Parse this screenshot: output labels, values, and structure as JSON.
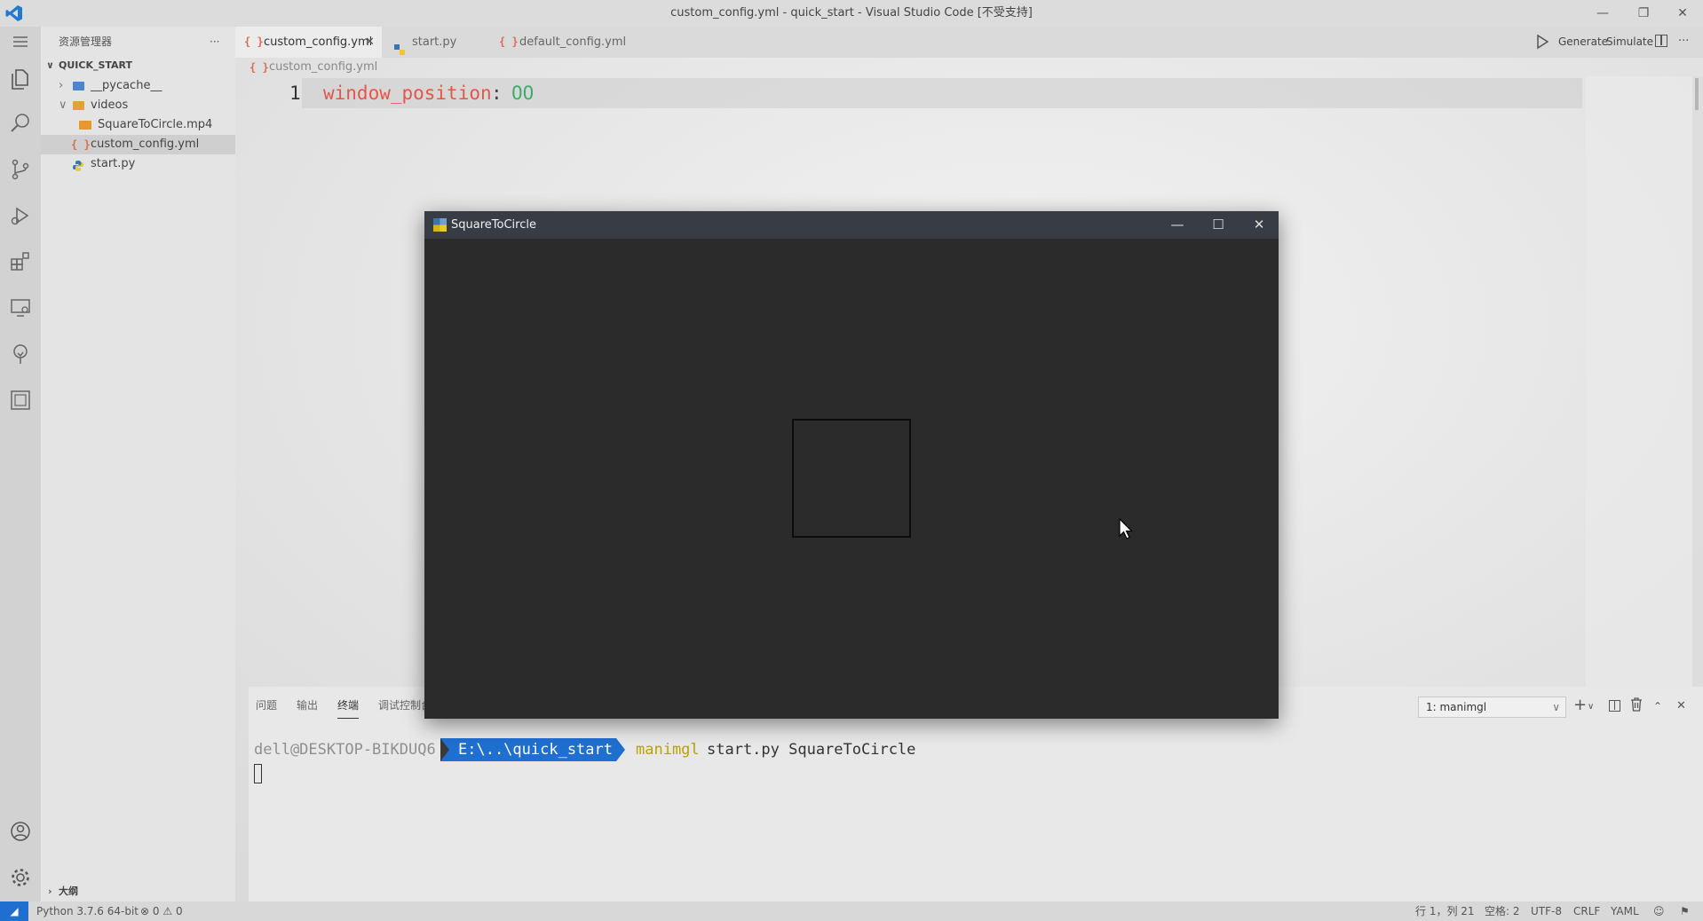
{
  "window": {
    "title": "custom_config.yml - quick_start - Visual Studio Code [不受支持]"
  },
  "sidebar": {
    "header": "资源管理器",
    "more": "···",
    "root": "QUICK_START",
    "items": [
      {
        "label": "__pycache__"
      },
      {
        "label": "videos"
      },
      {
        "label": "SquareToCircle.mp4"
      },
      {
        "label": "custom_config.yml"
      },
      {
        "label": "start.py"
      }
    ],
    "outline": "大纲"
  },
  "tabs": [
    {
      "label": "custom_config.yml",
      "icon": "{ }"
    },
    {
      "label": "start.py"
    },
    {
      "label": "default_config.yml",
      "icon": "{ }"
    }
  ],
  "toolbar": {
    "generate": "Generate",
    "simulate": "Simulate"
  },
  "editor": {
    "breadcrumb": "custom_config.yml",
    "line_number": "1",
    "key": "window_position",
    "colon": ":",
    "value": "OO"
  },
  "panel": {
    "tabs": [
      "问题",
      "输出",
      "终端",
      "调试控制台"
    ],
    "terminal_select": "1: manimgl",
    "prompt_user": "dell@DESKTOP-BIKDUQ6",
    "prompt_path": "E:\\..\\quick_start",
    "command_name": "manimgl",
    "command_args": "start.py SquareToCircle"
  },
  "manim_window": {
    "title": "SquareToCircle"
  },
  "statusbar": {
    "python": "Python 3.7.6 64-bit",
    "errors": "0",
    "warnings": "0",
    "position": "行 1，列 21",
    "spaces": "空格: 2",
    "encoding": "UTF-8",
    "eol": "CRLF",
    "language": "YAML"
  },
  "colors": {
    "accent": "#1f6fd0",
    "yaml_key": "#e45649",
    "yaml_value": "#3fae6a",
    "terminal_command": "#b8a400",
    "manim_bg": "#2b2b2b"
  }
}
